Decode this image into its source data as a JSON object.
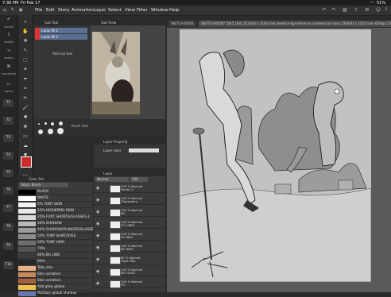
{
  "status_bar": {
    "time": "7:36 PM",
    "date": "Fri Feb 17",
    "battery": "51%"
  },
  "menu": [
    "File",
    "Edit",
    "Story",
    "Animation",
    "Layer",
    "Select",
    "View",
    "Filter",
    "Window",
    "Help"
  ],
  "rail": {
    "labels": [
      "correct",
      "modify",
      "option",
      "command",
      "layers",
      "layers"
    ],
    "numbers": [
      "T1",
      "T2",
      "T3",
      "T4",
      "T5",
      "T6",
      "T7",
      "T8",
      "T9",
      "T10"
    ]
  },
  "subtool": {
    "title": "Sub Tool",
    "items": [
      "Lasso fill 2",
      "Lasso fill 2"
    ],
    "add_label": "Add sub tool"
  },
  "subview": {
    "title": "Sub View"
  },
  "brush": {
    "size_title": "Brush Size"
  },
  "color_set": {
    "title": "Color Set",
    "set_name": "Toby's Brush",
    "rows": [
      {
        "label": "BLACK",
        "color": "#000000"
      },
      {
        "label": "WHITE",
        "color": "#ffffff"
      },
      {
        "label": "0% TOBY SKIN",
        "color": "#f4f4f4"
      },
      {
        "label": "10% HIGHKPMO SKIN",
        "color": "#e8e8e8"
      },
      {
        "label": "20% FURT SHORTS/GLASSES 2",
        "color": "#d8d8d8"
      },
      {
        "label": "30% SHADOW",
        "color": "#b9b9b9"
      },
      {
        "label": "40% SHADOW/PLUNGER/GLASSES",
        "color": "#9c9c9c"
      },
      {
        "label": "50% TOBY SHIRT/EYES",
        "color": "#8c8c8c"
      },
      {
        "label": "60% TOBY HAIR",
        "color": "#6e6e6e"
      },
      {
        "label": "70%",
        "color": "#555555"
      },
      {
        "label": "80% BG LINE",
        "color": "#3c3c3c"
      },
      {
        "label": "90%",
        "color": "#262626"
      },
      {
        "label": "Toby skin",
        "color": "#e8b086"
      },
      {
        "label": "Skin variation",
        "color": "#c9895e"
      },
      {
        "label": "Skin variation",
        "color": "#a8603e"
      },
      {
        "label": "Add glow global",
        "color": "#f2c14e"
      },
      {
        "label": "Multiply global shadow",
        "color": "#6b78b0"
      }
    ]
  },
  "layer_property": {
    "title": "Layer Property",
    "label_color": "Layer color"
  },
  "layers": {
    "title": "Layer",
    "mode": "Normal",
    "opacity": "100",
    "rows": [
      {
        "l1": "100 % Normal",
        "l2": "Folder 2"
      },
      {
        "l1": "100 % Normal",
        "l2": "Characters"
      },
      {
        "l1": "100 % Normal",
        "l2": "BG"
      },
      {
        "l1": "100 % Normal",
        "l2": "FG LINES"
      },
      {
        "l1": "100 % Normal",
        "l2": "FG INKS"
      },
      {
        "l1": "100 % Normal",
        "l2": "BG INKS"
      },
      {
        "l1": "80 % Normal",
        "l2": "Tight FBG"
      },
      {
        "l1": "100 % Normal",
        "l2": "BG FLATS"
      },
      {
        "l1": "100 % Normal",
        "l2": "FG"
      }
    ]
  },
  "canvas": {
    "tabs": [
      "SKETCH BOOK",
      "SKETCH BOOK* 26(5.1B4) 2510(6) x 3164 lines dewline-bg-reference commercial noise 2300(8) x 3150 lines 600dpi 23.7%"
    ]
  }
}
